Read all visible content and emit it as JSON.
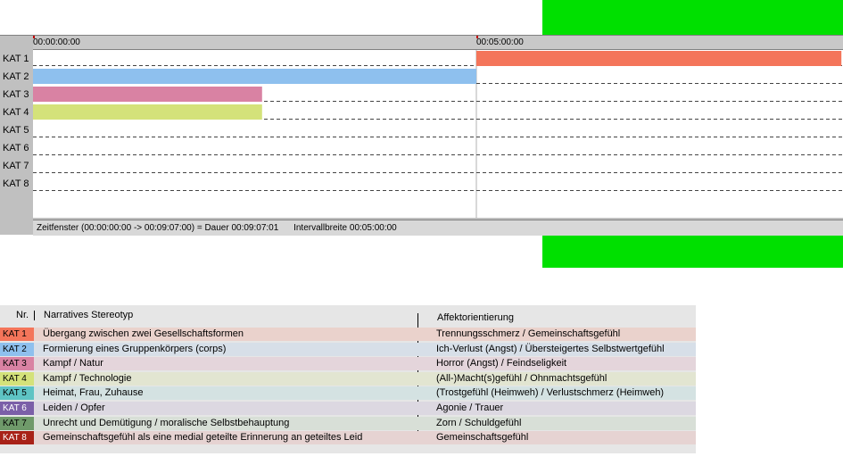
{
  "colors": {
    "green_block": "#00e000",
    "kat1": "#f4755a",
    "kat2": "#8ec0ee",
    "kat3": "#d982a3",
    "kat4": "#d4e27a",
    "kat5": "#5ec4c4",
    "kat6": "#7b5fa8",
    "kat7": "#6f9a6a",
    "kat8": "#a82218"
  },
  "chart_data": {
    "type": "timeline",
    "x_unit": "seconds",
    "x_range": [
      0,
      547
    ],
    "tick_labels": [
      {
        "value": 0,
        "label": "00:00:00:00"
      },
      {
        "value": 300,
        "label": "00:05:00:00"
      }
    ],
    "categories": [
      "KAT 1",
      "KAT 2",
      "KAT 3",
      "KAT 4",
      "KAT 5",
      "KAT 6",
      "KAT 7",
      "KAT 8"
    ],
    "segments": [
      {
        "category": "KAT 1",
        "start": 300,
        "end": 547,
        "color": "#f4755a"
      },
      {
        "category": "KAT 2",
        "start": 0,
        "end": 300,
        "color": "#8ec0ee"
      },
      {
        "category": "KAT 3",
        "start": 0,
        "end": 155,
        "color": "#d982a3"
      },
      {
        "category": "KAT 4",
        "start": 0,
        "end": 155,
        "color": "#d4e27a"
      }
    ],
    "grid": true
  },
  "status_bar": {
    "window_text": "Zeitfenster (00:00:00:00 -> 00:09:07:00) = Dauer 00:09:07:01",
    "interval_text": "Intervallbreite 00:05:00:00"
  },
  "legend": {
    "header_nr": "Nr.",
    "header_stereotyp": "Narratives Stereotyp",
    "header_affekt": "Affektorientierung",
    "rows": [
      {
        "kat": "KAT 1",
        "color": "#f4755a",
        "text_color": "#000000",
        "row_bg": "#ead2cc",
        "stereotyp": "Übergang zwischen zwei Gesellschaftsformen",
        "affekt": "Trennungsschmerz / Gemeinschaftsgefühl"
      },
      {
        "kat": "KAT 2",
        "color": "#8ec0ee",
        "text_color": "#000000",
        "row_bg": "#d7dfe8",
        "stereotyp": "Formierung eines Gruppenkörpers (corps)",
        "affekt": "Ich-Verlust (Angst) / Übersteigertes Selbstwertgefühl"
      },
      {
        "kat": "KAT 3",
        "color": "#d982a3",
        "text_color": "#000000",
        "row_bg": "#e4d5db",
        "stereotyp": "Kampf / Natur",
        "affekt": "Horror (Angst) / Feindseligkeit"
      },
      {
        "kat": "KAT 4",
        "color": "#d4e27a",
        "text_color": "#000000",
        "row_bg": "#e2e5d1",
        "stereotyp": "Kampf / Technologie",
        "affekt": "(All-)Macht(s)gefühl / Ohnmachtsgefühl"
      },
      {
        "kat": "KAT 5",
        "color": "#5ec4c4",
        "text_color": "#000000",
        "row_bg": "#d4e2e2",
        "stereotyp": "Heimat, Frau, Zuhause",
        "affekt": "(Trostgefühl (Heimweh) / Verlustschmerz (Heimweh)"
      },
      {
        "kat": "KAT 6",
        "color": "#7b5fa8",
        "text_color": "#ffffff",
        "row_bg": "#dcd8e1",
        "stereotyp": "Leiden / Opfer",
        "affekt": "Agonie / Trauer"
      },
      {
        "kat": "KAT 7",
        "color": "#6f9a6a",
        "text_color": "#000000",
        "row_bg": "#d8dfd7",
        "stereotyp": "Unrecht und Demütigung / moralische Selbstbehauptung",
        "affekt": "Zorn / Schuldgefühl"
      },
      {
        "kat": "KAT 8",
        "color": "#a82218",
        "text_color": "#ffffff",
        "row_bg": "#e6d3d2",
        "stereotyp": "Gemeinschaftsgefühl als eine medial geteilte Erinnerung an geteiltes Leid",
        "affekt": "Gemeinschaftsgefühl"
      }
    ]
  }
}
